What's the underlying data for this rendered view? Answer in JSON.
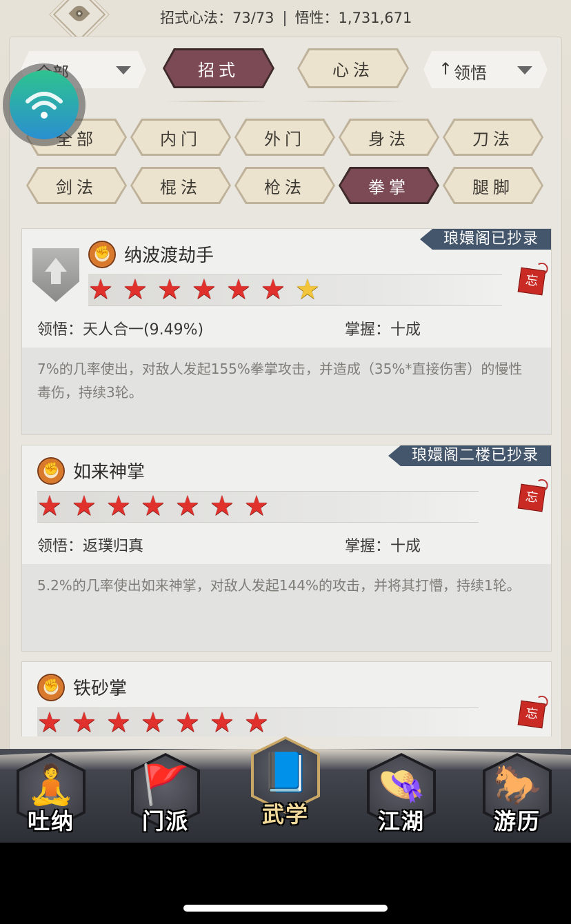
{
  "header": {
    "moves_label": "招式心法：73/73",
    "insight_label": "悟性：1,731,671"
  },
  "filters": {
    "category_dropdown": "全部",
    "sort_dropdown": "领悟",
    "main_tabs": [
      {
        "label": "招式",
        "active": true
      },
      {
        "label": "心法",
        "active": false
      }
    ],
    "type_tabs_row1": [
      {
        "label": "全部",
        "active": false
      },
      {
        "label": "内门",
        "active": false
      },
      {
        "label": "外门",
        "active": false
      },
      {
        "label": "身法",
        "active": false
      },
      {
        "label": "刀法",
        "active": false
      }
    ],
    "type_tabs_row2": [
      {
        "label": "剑法",
        "active": false
      },
      {
        "label": "棍法",
        "active": false
      },
      {
        "label": "枪法",
        "active": false
      },
      {
        "label": "拳掌",
        "active": true
      },
      {
        "label": "腿脚",
        "active": false
      }
    ]
  },
  "skills": [
    {
      "name": "纳波渡劫手",
      "ribbon": "琅嬛阁已抄录",
      "red_stars": 6,
      "gold_stars": 1,
      "insight": "领悟：天人合一(9.49%)",
      "mastery": "掌握：十成",
      "description": "7%的几率使出，对敌人发起155%拳掌攻击，并造成（35%*直接伤害）的慢性毒伤，持续3轮。",
      "tag": "忘"
    },
    {
      "name": "如来神掌",
      "ribbon": "琅嬛阁二楼已抄录",
      "red_stars": 7,
      "gold_stars": 0,
      "insight": "领悟：返璞归真",
      "mastery": "掌握：十成",
      "description": "5.2%的几率使出如来神掌，对敌人发起144%的攻击，并将其打懵，持续1轮。",
      "tag": "忘"
    },
    {
      "name": "铁砂掌",
      "red_stars": 7,
      "gold_stars": 0,
      "tag": "忘"
    }
  ],
  "bottom_nav": [
    {
      "label": "吐纳",
      "active": false
    },
    {
      "label": "门派",
      "active": false
    },
    {
      "label": "武学",
      "active": true
    },
    {
      "label": "江湖",
      "active": false
    },
    {
      "label": "游历",
      "active": false
    }
  ],
  "colors": {
    "active_tab": "#7b4a55",
    "ribbon": "#44566b",
    "star_red": "#e0312d",
    "star_gold": "#f2c53b"
  }
}
